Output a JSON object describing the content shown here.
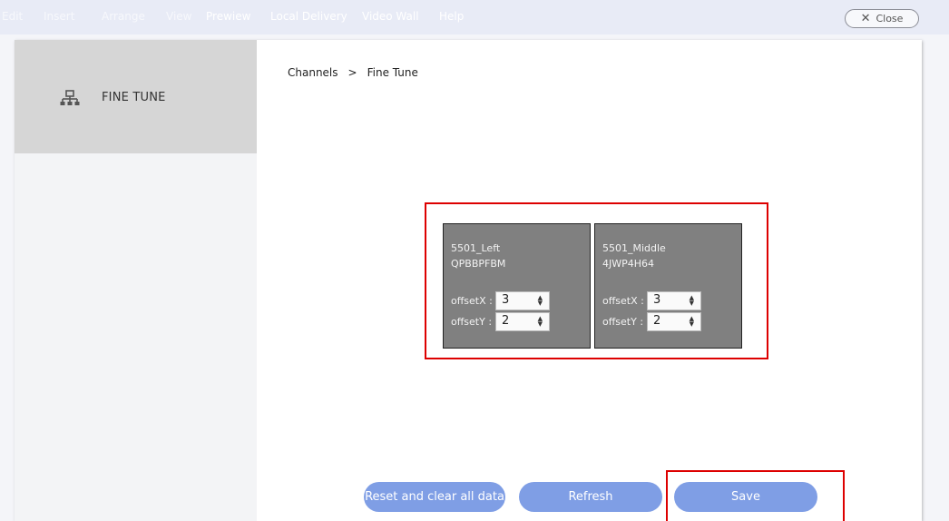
{
  "menu": {
    "items": [
      {
        "label": "Edit"
      },
      {
        "label": "Insert"
      },
      {
        "label": "Arrange"
      },
      {
        "label": "View"
      },
      {
        "label": "Prewiew"
      },
      {
        "label": "Local Delivery"
      },
      {
        "label": "Video Wall"
      },
      {
        "label": "Help"
      }
    ],
    "close_label": "Close",
    "close_icon": "close-icon"
  },
  "sidebar": {
    "items": [
      {
        "label": "FINE TUNE",
        "icon": "network-tree-icon"
      }
    ]
  },
  "breadcrumb": {
    "parent": "Channels",
    "separator": ">",
    "current": "Fine Tune"
  },
  "channels": [
    {
      "name": "5501_Left",
      "id": "QPBBPFBM",
      "offsetX_label": "offsetX :",
      "offsetX": "3",
      "offsetY_label": "offsetY :",
      "offsetY": "2"
    },
    {
      "name": "5501_Middle",
      "id": "4JWP4H64",
      "offsetX_label": "offsetX :",
      "offsetX": "3",
      "offsetY_label": "offsetY :",
      "offsetY": "2"
    }
  ],
  "actions": {
    "reset_label": "Reset and clear all data",
    "refresh_label": "Refresh",
    "save_label": "Save"
  },
  "colors": {
    "accent_button": "#7f9ee5",
    "highlight_border": "#dd0000",
    "channel_tile": "#808080",
    "sidebar_selected": "#d6d6d6"
  }
}
